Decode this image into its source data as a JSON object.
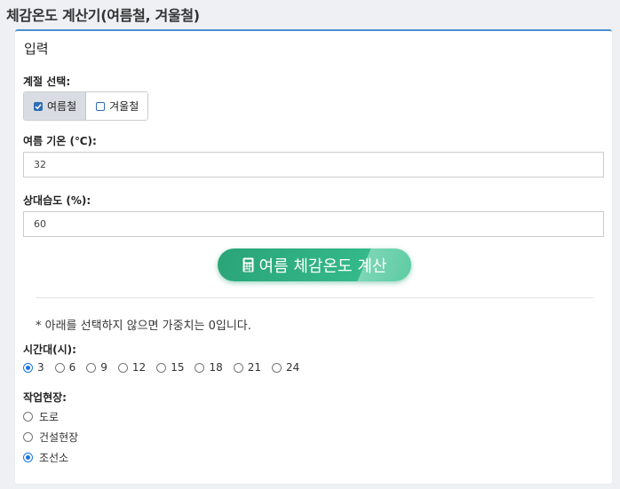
{
  "page": {
    "title": "체감온도 계산기(여름철, 겨울철)"
  },
  "card": {
    "title": "입력"
  },
  "season": {
    "label": "계절 선택:",
    "options": [
      {
        "label": "여름철",
        "selected": true
      },
      {
        "label": "겨울철",
        "selected": false
      }
    ]
  },
  "temperature": {
    "label": "여름 기온 (℃):",
    "value": "32"
  },
  "humidity": {
    "label": "상대습도 (%):",
    "value": "60"
  },
  "calculate": {
    "label": "여름 체감온도 계산",
    "icon": "calculator-icon"
  },
  "note": "* 아래를 선택하지 않으면 가중치는 0입니다.",
  "hours": {
    "label": "시간대(시):",
    "options": [
      "3",
      "6",
      "9",
      "12",
      "15",
      "18",
      "21",
      "24"
    ],
    "selected": "3"
  },
  "site": {
    "label": "작업현장:",
    "options": [
      "도로",
      "건설현장",
      "조선소"
    ],
    "selected": "조선소"
  },
  "colors": {
    "accent": "#4a8fd0",
    "button": "#2aa478",
    "radio": "#1a73e8"
  }
}
